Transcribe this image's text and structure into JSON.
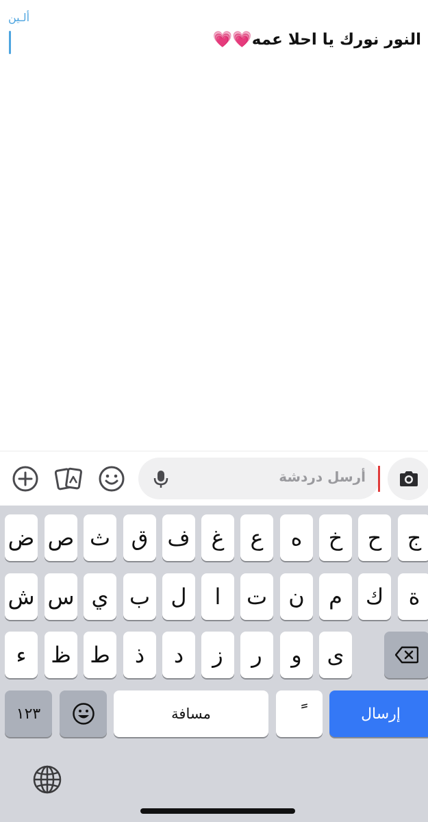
{
  "chat": {
    "sender_name": "ألـين",
    "message": "النور نورك يا احلا عمه💗💗"
  },
  "input": {
    "placeholder": "أرسل دردشة",
    "icons": [
      "plus-circle-icon",
      "cards-icon",
      "smiley-icon",
      "microphone-icon",
      "camera-icon"
    ]
  },
  "keyboard": {
    "row1": [
      "ج",
      "ح",
      "خ",
      "ه",
      "ع",
      "غ",
      "ف",
      "ق",
      "ث",
      "ص",
      "ض"
    ],
    "row2": [
      "ة",
      "ك",
      "م",
      "ن",
      "ت",
      "ا",
      "ل",
      "ب",
      "ي",
      "س",
      "ش"
    ],
    "row3": [
      "ى",
      "و",
      "ر",
      "ز",
      "د",
      "ذ",
      "ط",
      "ظ",
      "ء"
    ],
    "numbers_label": "١٢٣",
    "space_label": "مسافة",
    "diacritic_label": "ً",
    "send_label": "إرسال"
  },
  "colors": {
    "accent_blue": "#3478f6",
    "name_blue": "#4ea5e0",
    "caret_red": "#e03c3c",
    "keyboard_bg": "#d3d5db"
  }
}
